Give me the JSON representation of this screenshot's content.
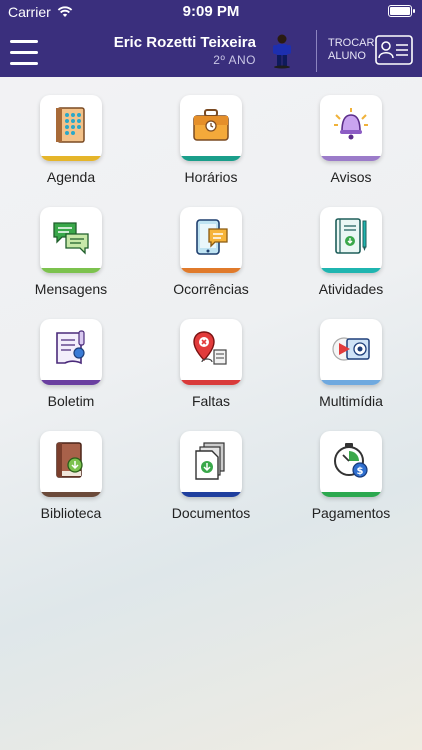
{
  "status_bar": {
    "carrier": "Carrier",
    "time": "9:09 PM"
  },
  "header": {
    "student_name": "Eric Rozetti Teixeira",
    "student_grade": "2º ANO",
    "swap_label_line1": "TROCAR",
    "swap_label_line2": "ALUNO",
    "colors": {
      "background": "#3a2f7d",
      "text": "#ffffff"
    }
  },
  "menu": {
    "items": [
      {
        "label": "Agenda",
        "icon": "calendar-icon",
        "color": "#e5b52a"
      },
      {
        "label": "Horários",
        "icon": "briefcase-icon",
        "color": "#1a9e8a"
      },
      {
        "label": "Avisos",
        "icon": "bell-icon",
        "color": "#9b7bc9"
      },
      {
        "label": "Mensagens",
        "icon": "chat-bubbles-icon",
        "color": "#7cc24e"
      },
      {
        "label": "Ocorrências",
        "icon": "mobile-message-icon",
        "color": "#e07a2b"
      },
      {
        "label": "Atividades",
        "icon": "notebook-download-icon",
        "color": "#1fb5b0"
      },
      {
        "label": "Boletim",
        "icon": "report-card-icon",
        "color": "#6a3fa0"
      },
      {
        "label": "Faltas",
        "icon": "location-alert-icon",
        "color": "#d93a3a"
      },
      {
        "label": "Multimídia",
        "icon": "media-player-icon",
        "color": "#6fa9df"
      },
      {
        "label": "Biblioteca",
        "icon": "book-download-icon",
        "color": "#6b4a3a"
      },
      {
        "label": "Documentos",
        "icon": "documents-download-icon",
        "color": "#1f3f9e"
      },
      {
        "label": "Pagamentos",
        "icon": "payment-clock-icon",
        "color": "#2ca84f"
      }
    ]
  }
}
